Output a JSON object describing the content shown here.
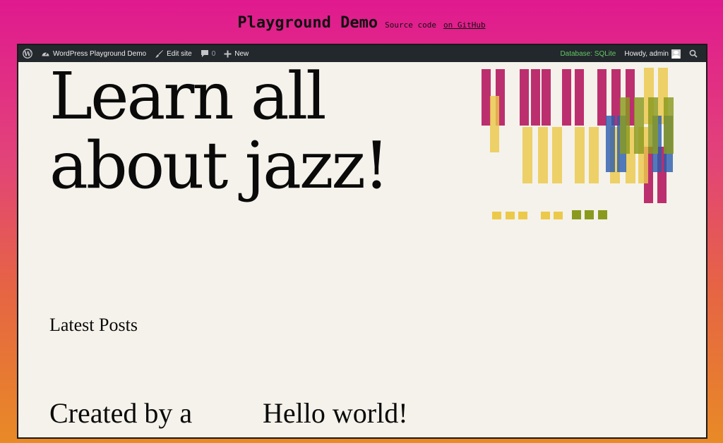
{
  "header": {
    "title": "Playground Demo",
    "source_prefix": "Source code",
    "source_link": "on GitHub"
  },
  "admin_bar": {
    "site_name": "WordPress Playground Demo",
    "edit_site": "Edit site",
    "comments_count": "0",
    "new_label": "New",
    "database_label": "Database: SQLite",
    "greeting": "Howdy, admin"
  },
  "content": {
    "hero_line1": "Learn all",
    "hero_line2": "about jazz!",
    "latest_posts": "Latest Posts",
    "posts": [
      {
        "title": "Created by a"
      },
      {
        "title": "Hello world!"
      }
    ]
  },
  "colors": {
    "admin_bar_bg": "#23282d",
    "database_green": "#64c864",
    "page_bg": "#f4f2ea",
    "art_magenta": "#b5155e",
    "art_yellow": "#ecc94b",
    "art_olive": "#8a9a1e",
    "art_blue": "#2a5db0"
  },
  "icons": {
    "wordpress": "wordpress-logo-icon",
    "dashboard": "dashboard-gauge-icon",
    "edit": "brush-icon",
    "comments": "comment-bubble-icon",
    "new": "plus-icon",
    "search": "search-icon"
  }
}
